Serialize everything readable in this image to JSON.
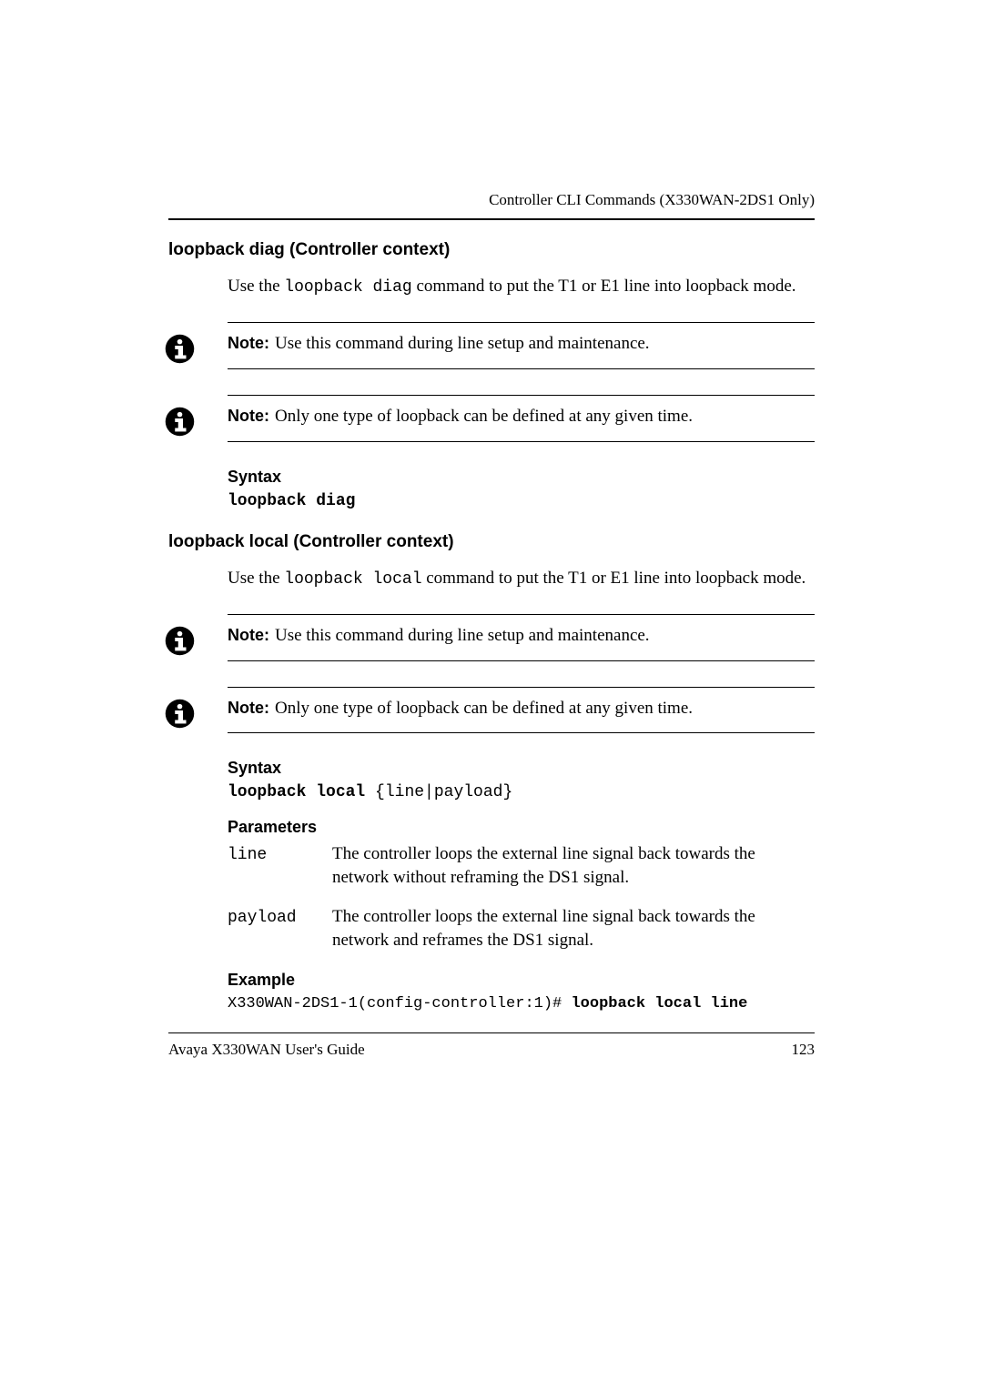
{
  "running_head": "Controller CLI Commands (X330WAN-2DS1 Only)",
  "s1": {
    "title": "loopback diag (Controller context)",
    "intro_a": "Use the ",
    "intro_cmd": "loopback diag",
    "intro_b": " command to put the T1 or E1 line into loopback mode.",
    "note1_label": "Note:",
    "note1": "Use this command during line setup and maintenance.",
    "note2_label": "Note:",
    "note2": "Only one type of loopback can be defined at any given time.",
    "syntax_h": "Syntax",
    "syntax_cmd": "loopback diag"
  },
  "s2": {
    "title": "loopback local (Controller context)",
    "intro_a": "Use the ",
    "intro_cmd": "loopback local",
    "intro_b": " command to put the T1 or E1 line into loopback mode.",
    "note1_label": "Note:",
    "note1": "Use this command during line setup and maintenance.",
    "note2_label": "Note:",
    "note2": "Only one type of loopback can be defined at any given time.",
    "syntax_h": "Syntax",
    "syntax_cmd": "loopback local",
    "syntax_args": " {line|payload}",
    "params_h": "Parameters",
    "params": [
      {
        "name": "line",
        "desc": "The controller loops the external line signal back towards the network without reframing the DS1 signal."
      },
      {
        "name": "payload",
        "desc": "The controller loops the external line signal back towards the network and reframes the DS1 signal."
      }
    ],
    "example_h": "Example",
    "example_prompt": "X330WAN-2DS1-1(config-controller:1)# ",
    "example_cmd": "loopback local line"
  },
  "footer": {
    "left": "Avaya X330WAN User's Guide",
    "right": "123"
  }
}
